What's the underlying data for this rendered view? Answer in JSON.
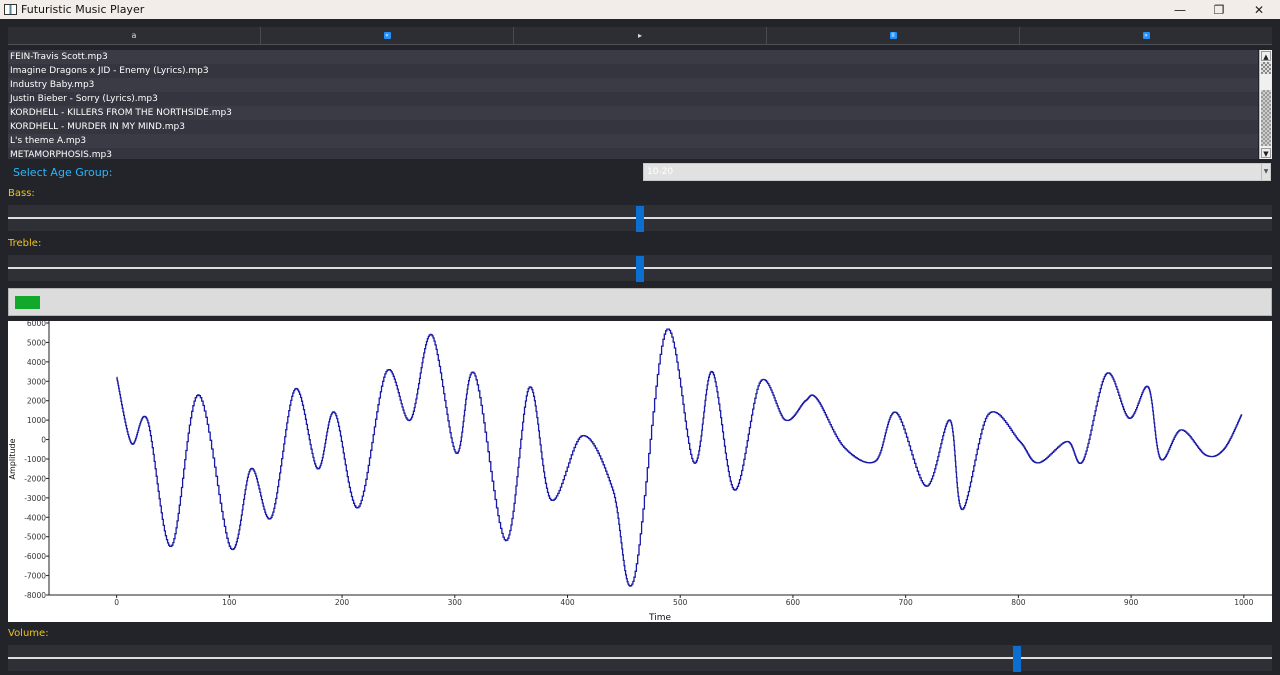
{
  "window": {
    "title": "Futuristic Music Player",
    "icon": "app-window-icon",
    "controls": {
      "minimize": "—",
      "maximize": "❐",
      "close": "✕"
    }
  },
  "controls": {
    "buttons": [
      {
        "name": "open-button",
        "icon": "folder-icon",
        "glyph": "a"
      },
      {
        "name": "previous-button",
        "icon": "rewind-icon",
        "glyph": "«"
      },
      {
        "name": "play-button",
        "icon": "play-icon",
        "glyph": "▸"
      },
      {
        "name": "pause-button",
        "icon": "pause-icon",
        "glyph": "II"
      },
      {
        "name": "next-button",
        "icon": "fast-forward-icon",
        "glyph": "»"
      }
    ],
    "accent": "#1e90ff"
  },
  "playlist": {
    "items": [
      "FEIN-Travis Scott.mp3",
      "Imagine Dragons x JID - Enemy (Lyrics).mp3",
      "Industry Baby.mp3",
      "Justin Bieber - Sorry (Lyrics).mp3",
      "KORDHELL - KILLERS FROM THE NORTHSIDE.mp3",
      "KORDHELL - MURDER IN MY MIND.mp3",
      "L's theme A.mp3",
      "METAMORPHOSIS.mp3"
    ]
  },
  "age_group": {
    "label": "Select Age Group:",
    "selected": "10-20"
  },
  "sliders": {
    "bass": {
      "label": "Bass:",
      "level": 0.5
    },
    "treble": {
      "label": "Treble:",
      "level": 0.5
    },
    "volume": {
      "label": "Volume:",
      "level": 0.8
    }
  },
  "progress": {
    "value_fraction": 0.02,
    "color": "#11a82b"
  },
  "chart_data": {
    "type": "line",
    "title": "",
    "xlabel": "Time",
    "ylabel": "Amplitude",
    "xlim": [
      -60,
      1025
    ],
    "ylim": [
      -8000,
      6000
    ],
    "xticks": [
      0,
      100,
      200,
      300,
      400,
      500,
      600,
      700,
      800,
      900,
      1000
    ],
    "yticks": [
      6000,
      5000,
      4000,
      3000,
      2000,
      1000,
      0,
      -1000,
      -2000,
      -3000,
      -4000,
      -5000,
      -6000,
      -7000,
      -8000
    ],
    "grid": false,
    "line_color": "#1a1aa8",
    "series": [
      {
        "x": [
          0,
          13,
          27,
          48,
          72,
          101,
          119,
          137,
          158,
          178,
          193,
          214,
          239,
          260,
          279,
          301,
          317,
          345,
          366,
          385,
          413,
          440,
          458,
          487,
          512,
          528,
          548,
          571,
          593,
          611,
          621,
          645,
          673,
          691,
          718,
          739,
          750,
          773,
          801,
          817,
          843,
          857,
          878,
          898,
          915,
          926,
          944,
          966,
          982,
          998
        ],
        "y": [
          3200,
          -200,
          1000,
          -5500,
          2300,
          -5600,
          -1500,
          -4000,
          2600,
          -1500,
          1400,
          -3500,
          3500,
          1000,
          5400,
          -700,
          3400,
          -5200,
          2700,
          -3100,
          200,
          -2600,
          -7300,
          5600,
          -1200,
          3500,
          -2600,
          3000,
          1000,
          2000,
          2100,
          -400,
          -1100,
          1400,
          -2400,
          1000,
          -3600,
          1300,
          -100,
          -1200,
          -100,
          -1100,
          3400,
          1100,
          2700,
          -1000,
          500,
          -800,
          -500,
          1300
        ]
      }
    ]
  }
}
